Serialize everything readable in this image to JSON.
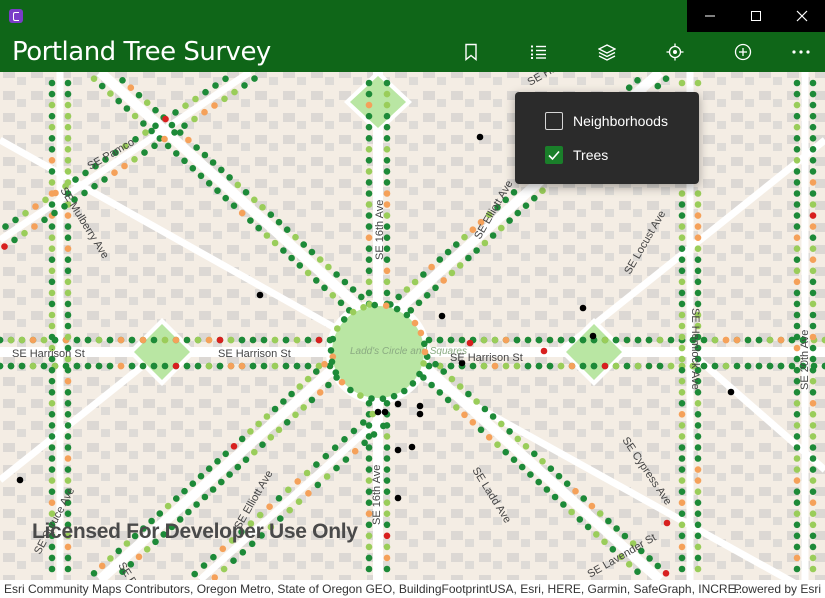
{
  "window": {
    "app_icon": "app-logo-icon",
    "controls": [
      "minimize-icon",
      "maximize-icon",
      "close-icon"
    ]
  },
  "appbar": {
    "title": "Portland Tree Survey",
    "commands": [
      "bookmark-icon",
      "legend-list-icon",
      "layers-icon",
      "locate-icon",
      "add-icon",
      "more-icon"
    ]
  },
  "layers": {
    "items": [
      {
        "label": "Neighborhoods",
        "checked": false
      },
      {
        "label": "Trees",
        "checked": true
      }
    ]
  },
  "map": {
    "center_label": "Ladd's Circle and Squares",
    "street_labels": [
      "SE Pamco",
      "SE Mulberry Ave",
      "SE 16th Ave",
      "SE Elliott Ave",
      "SE Locust Ave",
      "SE Harrison St",
      "SE Harrison St",
      "SE Harrison St",
      "SE Hemlock Ave",
      "SE 20th Ave",
      "SE 16th Ave",
      "SE Ladd Ave",
      "SE Cypress Ave",
      "SE Elliott Ave",
      "SE Spruce Ave",
      "SE Birch",
      "SE Lavender St",
      "SE Hazel"
    ],
    "colors": {
      "tree": "#1d8a38",
      "tree_light": "#9acd5a",
      "tree_orange": "#f5a15a",
      "tree_red": "#d8201f",
      "park": "#b9e6a3"
    }
  },
  "watermark": "Licensed For Developer Use Only",
  "attribution": "Esri Community Maps Contributors, Oregon Metro, State of Oregon GEO, BuildingFootprintUSA, Esri, HERE, Garmin, SafeGraph, INCRE...",
  "powered_by": "Powered by Esri"
}
